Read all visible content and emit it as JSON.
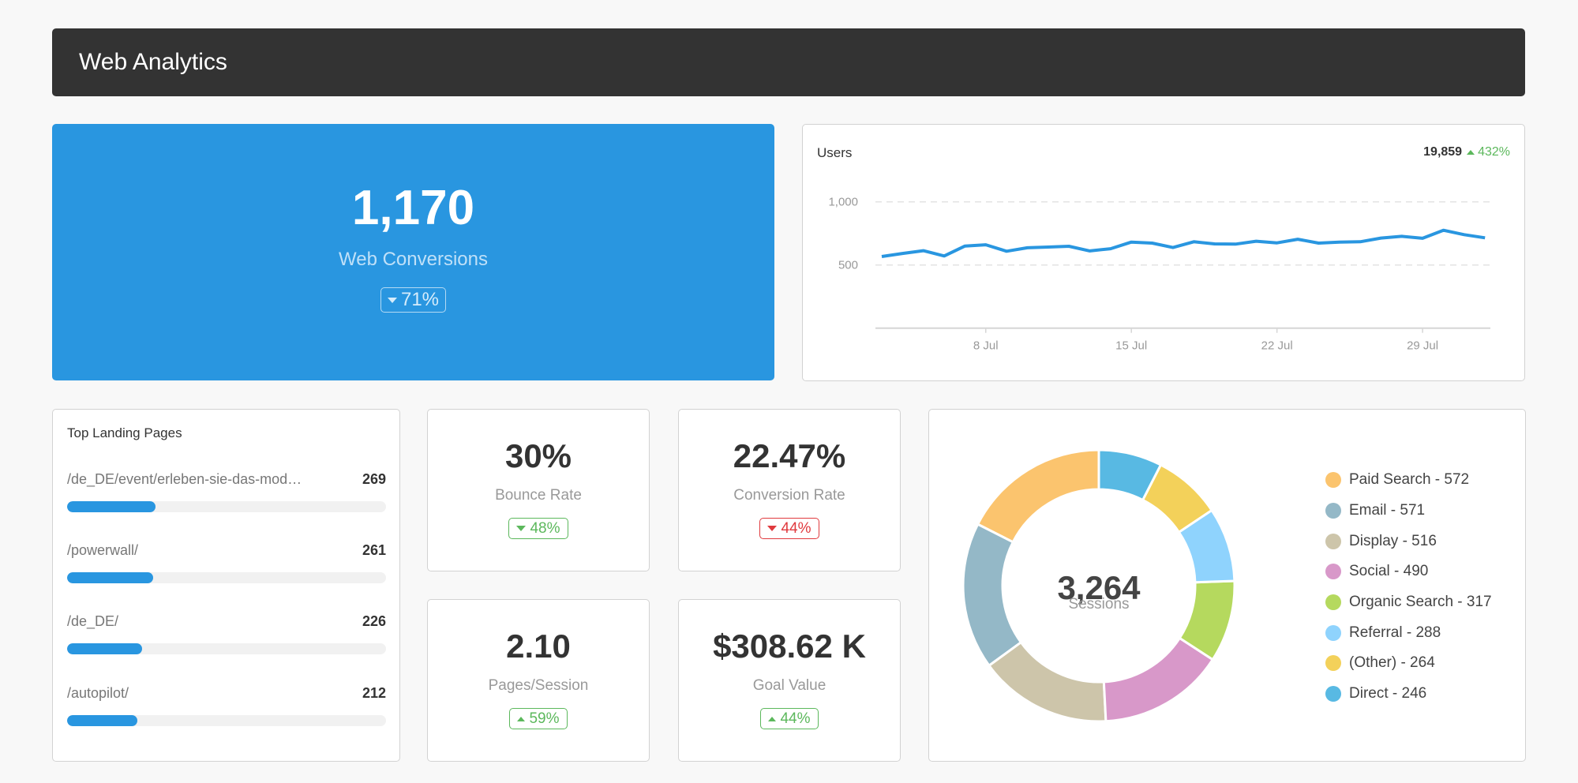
{
  "header": {
    "title": "Web Analytics"
  },
  "web_conversions": {
    "value": "1,170",
    "label": "Web Conversions",
    "change": "71%",
    "change_direction": "down"
  },
  "users": {
    "title": "Users",
    "total": "19,859",
    "change": "432%",
    "change_direction": "up"
  },
  "top_landing_pages": {
    "title": "Top Landing Pages",
    "items": [
      {
        "label": "/de_DE/event/erleben-sie-das-mod…",
        "value": "269",
        "fill_fraction": 0.277
      },
      {
        "label": "/powerwall/",
        "value": "261",
        "fill_fraction": 0.27
      },
      {
        "label": "/de_DE/",
        "value": "226",
        "fill_fraction": 0.235
      },
      {
        "label": "/autopilot/",
        "value": "212",
        "fill_fraction": 0.22
      }
    ]
  },
  "kpis": [
    {
      "value": "30%",
      "label": "Bounce Rate",
      "change": "48%",
      "change_direction": "down",
      "status": "good"
    },
    {
      "value": "22.47%",
      "label": "Conversion Rate",
      "change": "44%",
      "change_direction": "down",
      "status": "bad"
    },
    {
      "value": "2.10",
      "label": "Pages/Session",
      "change": "59%",
      "change_direction": "up",
      "status": "good"
    },
    {
      "value": "$308.62 K",
      "label": "Goal Value",
      "change": "44%",
      "change_direction": "up",
      "status": "good"
    }
  ],
  "sessions": {
    "total": "3,264",
    "label": "Sessions"
  },
  "colors": {
    "accent": "#2996e0",
    "header_bg": "#333333",
    "positive": "#5cb85c",
    "negative": "#e03a3e"
  },
  "chart_data": [
    {
      "type": "line",
      "title": "Users",
      "xlabel": "",
      "ylabel": "",
      "x": [
        "3 Jul",
        "4 Jul",
        "5 Jul",
        "6 Jul",
        "7 Jul",
        "8 Jul",
        "9 Jul",
        "10 Jul",
        "11 Jul",
        "12 Jul",
        "13 Jul",
        "14 Jul",
        "15 Jul",
        "16 Jul",
        "17 Jul",
        "18 Jul",
        "19 Jul",
        "20 Jul",
        "21 Jul",
        "22 Jul",
        "23 Jul",
        "24 Jul",
        "25 Jul",
        "26 Jul",
        "27 Jul",
        "28 Jul",
        "29 Jul",
        "30 Jul",
        "31 Jul",
        "1 Aug"
      ],
      "series": [
        {
          "name": "Users",
          "color": "#2996e0",
          "values": [
            567,
            591,
            613,
            571,
            650,
            660,
            609,
            636,
            642,
            648,
            611,
            629,
            681,
            673,
            638,
            684,
            667,
            665,
            688,
            675,
            704,
            673,
            681,
            684,
            713,
            727,
            711,
            775,
            740,
            715
          ]
        }
      ],
      "ylim": [
        0,
        1000
      ],
      "yticks": [
        500,
        1000
      ],
      "ytick_labels": [
        "500",
        "1,000"
      ],
      "xticks": [
        "8 Jul",
        "15 Jul",
        "22 Jul",
        "29 Jul"
      ],
      "grid": true,
      "legend": "none"
    },
    {
      "type": "pie",
      "title": "Sessions",
      "donut": true,
      "center_value": "3,264",
      "center_label": "Sessions",
      "categories": [
        "Paid Search",
        "Email",
        "Display",
        "Social",
        "Organic Search",
        "Referral",
        "(Other)",
        "Direct"
      ],
      "values": [
        572,
        571,
        516,
        490,
        317,
        288,
        264,
        246
      ],
      "colors": [
        "#fbc46e",
        "#94b8c7",
        "#cdc5aa",
        "#d898c9",
        "#b5d95e",
        "#8fd3fd",
        "#f3d15a",
        "#58b9e3"
      ],
      "legend": "right",
      "direction": "counterclockwise-from-top"
    }
  ]
}
